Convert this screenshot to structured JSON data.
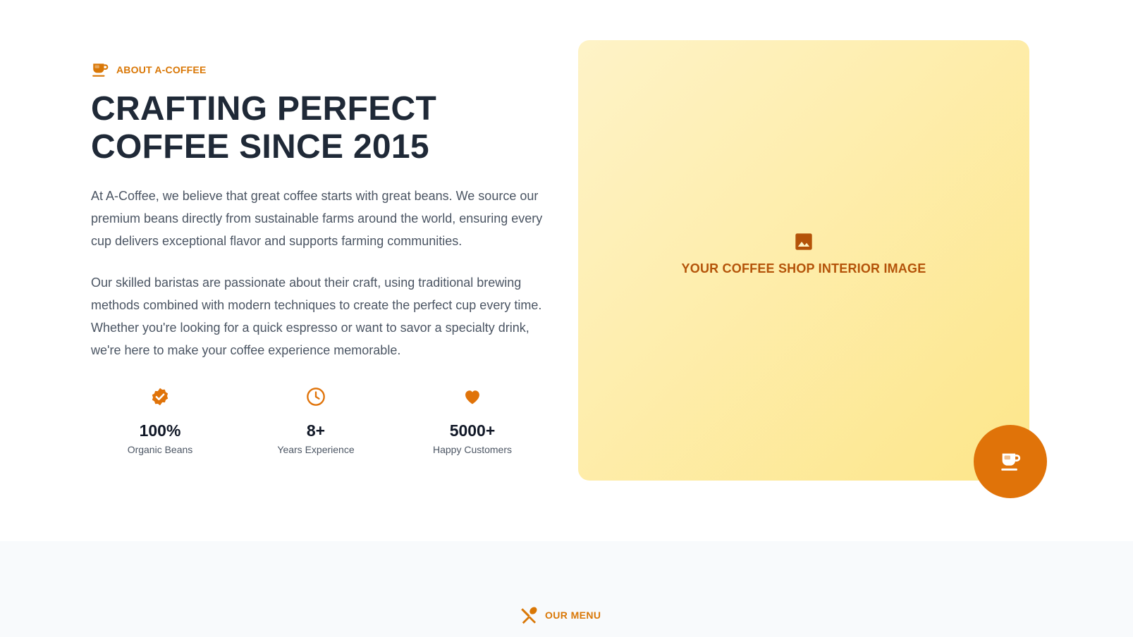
{
  "about": {
    "eyebrow": "ABOUT A-COFFEE",
    "eyebrow_icon": "coffee-cup-icon",
    "headline_line1": "CRAFTING PERFECT",
    "headline_line2": "COFFEE SINCE 2015",
    "paragraph1": "At A-Coffee, we believe that great coffee starts with great beans. We source our premium beans directly from sustainable farms around the world, ensuring every cup delivers exceptional flavor and supports farming communities.",
    "paragraph2": "Our skilled baristas are passionate about their craft, using traditional brewing methods combined with modern techniques to create the perfect cup every time. Whether you're looking for a quick espresso or want to savor a specialty drink, we're here to make your coffee experience memorable.",
    "stats": [
      {
        "icon": "verified-badge-icon",
        "value": "100%",
        "label": "Organic Beans"
      },
      {
        "icon": "clock-icon",
        "value": "8+",
        "label": "Years Experience"
      },
      {
        "icon": "heart-icon",
        "value": "5000+",
        "label": "Happy Customers"
      }
    ],
    "image_placeholder": {
      "icon": "image-icon",
      "text": "YOUR COFFEE SHOP INTERIOR IMAGE"
    },
    "fab_icon": "coffee-cup-icon"
  },
  "menu": {
    "eyebrow": "OUR MENU",
    "eyebrow_icon": "fork-spoon-icon"
  },
  "colors": {
    "accent": "#d97706",
    "accent_dark": "#b45309",
    "fab": "#e07309",
    "heading": "#1f2937",
    "body": "#4b5563",
    "card_gradient_start": "#fef3c7",
    "card_gradient_end": "#fde68a",
    "menu_bg": "#f8fafc"
  }
}
